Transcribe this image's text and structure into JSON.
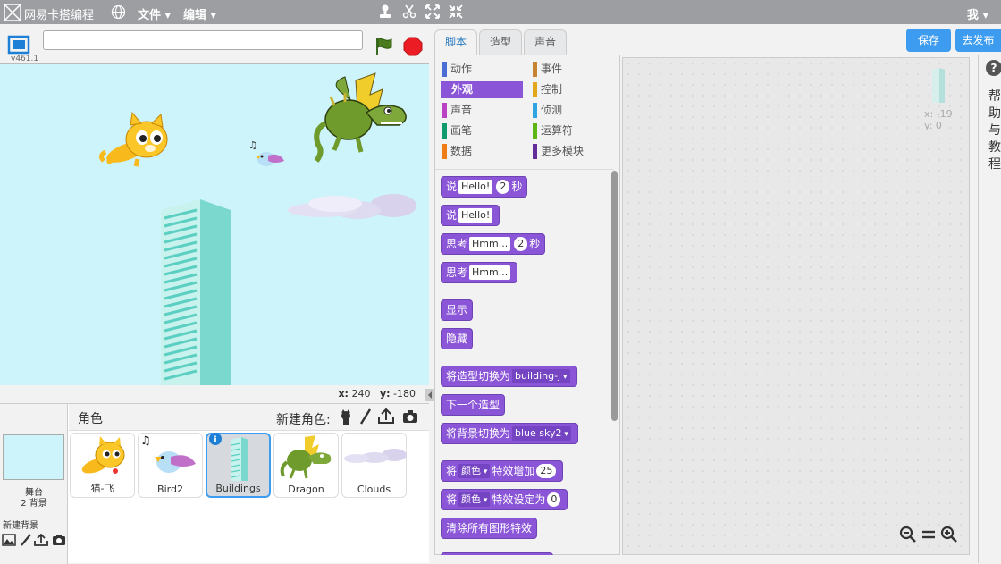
{
  "app": {
    "title": "网易卡搭编程",
    "menus": [
      "文件",
      "编辑"
    ],
    "user": "我"
  },
  "stage": {
    "version": "v461.1",
    "project_title": "",
    "coords": {
      "x_label": "x:",
      "x_value": "240",
      "y_label": "y:",
      "y_value": "-180"
    }
  },
  "sprite_pane": {
    "header": "角色",
    "new_sprite_label": "新建角色:",
    "stage_label": "舞台",
    "stage_count": "2 背景",
    "new_backdrop_label": "新建背景",
    "sprites": [
      {
        "name": "猫-飞",
        "selected": false
      },
      {
        "name": "Bird2",
        "selected": false
      },
      {
        "name": "Buildings",
        "selected": true
      },
      {
        "name": "Dragon",
        "selected": false
      },
      {
        "name": "Clouds",
        "selected": false
      }
    ]
  },
  "tabs": [
    {
      "label": "脚本",
      "active": true
    },
    {
      "label": "造型",
      "active": false
    },
    {
      "label": "声音",
      "active": false
    }
  ],
  "buttons": {
    "save": "保存",
    "publish": "去发布"
  },
  "categories": [
    {
      "label": "动作",
      "color": "#4a6cd4",
      "active": false
    },
    {
      "label": "事件",
      "color": "#c88330",
      "active": false
    },
    {
      "label": "外观",
      "color": "#8a55d7",
      "active": true
    },
    {
      "label": "控制",
      "color": "#e1a91a",
      "active": false
    },
    {
      "label": "声音",
      "color": "#bb42c3",
      "active": false
    },
    {
      "label": "侦测",
      "color": "#2ca5e2",
      "active": false
    },
    {
      "label": "画笔",
      "color": "#0e9a6c",
      "active": false
    },
    {
      "label": "运算符",
      "color": "#5cb712",
      "active": false
    },
    {
      "label": "数据",
      "color": "#ee7d16",
      "active": false
    },
    {
      "label": "更多模块",
      "color": "#632d99",
      "active": false
    }
  ],
  "blocks": {
    "say_timed": {
      "a": "说",
      "text": "Hello!",
      "num": "2",
      "b": "秒"
    },
    "say": {
      "a": "说",
      "text": "Hello!"
    },
    "think_timed": {
      "a": "思考",
      "text": "Hmm...",
      "num": "2",
      "b": "秒"
    },
    "think": {
      "a": "思考",
      "text": "Hmm..."
    },
    "show": "显示",
    "hide": "隐藏",
    "switch_costume": {
      "a": "将造型切换为",
      "value": "building-j"
    },
    "next_costume": "下一个造型",
    "switch_backdrop": {
      "a": "将背景切换为",
      "value": "blue sky2"
    },
    "change_effect": {
      "a": "将",
      "effect": "颜色",
      "b": "特效增加",
      "num": "25"
    },
    "set_effect": {
      "a": "将",
      "effect": "颜色",
      "b": "特效设定为",
      "num": "0"
    },
    "clear_effects": "清除所有图形特效"
  },
  "script_area": {
    "sprite_x": "x: -19",
    "sprite_y": "y: 0"
  },
  "help": {
    "icon": "?",
    "text": "帮助与教程"
  },
  "chart_data": {}
}
